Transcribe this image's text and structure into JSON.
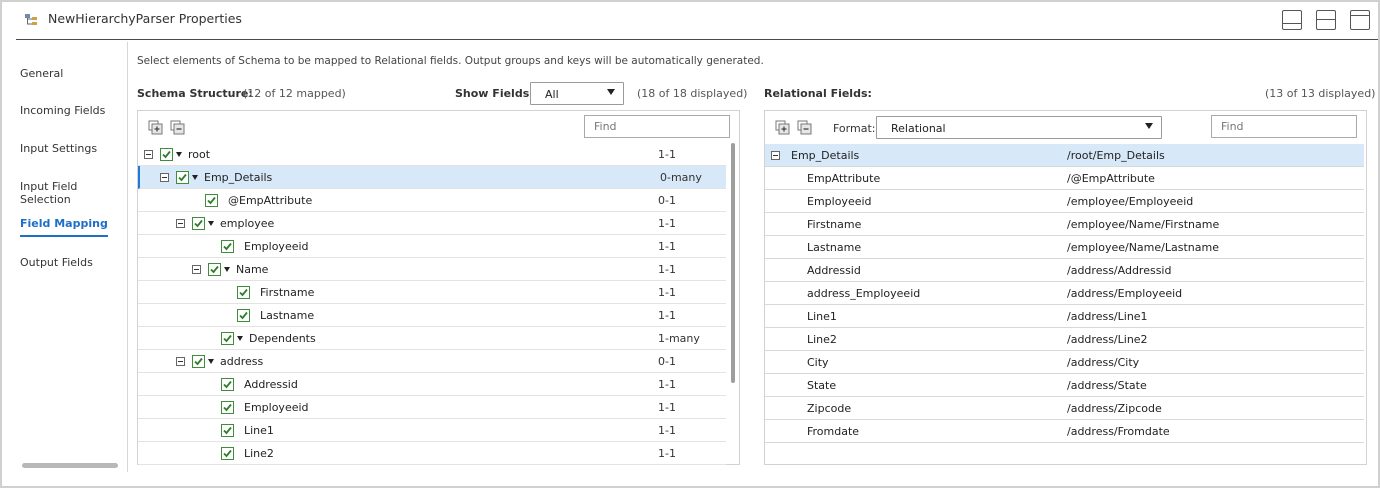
{
  "window": {
    "title": "NewHierarchyParser Properties"
  },
  "nav": {
    "items": [
      {
        "label": "General",
        "active": false
      },
      {
        "label": "Incoming Fields",
        "active": false
      },
      {
        "label": "Input Settings",
        "active": false
      },
      {
        "label": "Input Field Selection",
        "active": false
      },
      {
        "label": "Field Mapping",
        "active": true
      },
      {
        "label": "Output Fields",
        "active": false
      }
    ]
  },
  "instruction": "Select elements of Schema to be mapped to Relational fields. Output groups and keys will be automatically generated.",
  "schema": {
    "title": "Schema Structure:",
    "mapped": "(12 of 12 mapped)",
    "show_fields_label": "Show Fields:",
    "show_fields_value": "All",
    "displayed": "(18 of 18 displayed)",
    "find_placeholder": "Find",
    "rows": [
      {
        "label": "root",
        "card": "1-1",
        "level": 0,
        "expander": true,
        "caret": true,
        "selected": false
      },
      {
        "label": "Emp_Details",
        "card": "0-many",
        "level": 1,
        "expander": true,
        "caret": true,
        "selected": true
      },
      {
        "label": "@EmpAttribute",
        "card": "0-1",
        "level": 2,
        "expander": false,
        "caret": false,
        "selected": false
      },
      {
        "label": "employee",
        "card": "1-1",
        "level": 2,
        "expander": true,
        "caret": true,
        "selected": false
      },
      {
        "label": "Employeeid",
        "card": "1-1",
        "level": 3,
        "expander": false,
        "caret": false,
        "selected": false
      },
      {
        "label": "Name",
        "card": "1-1",
        "level": 3,
        "expander": true,
        "caret": true,
        "selected": false
      },
      {
        "label": "Firstname",
        "card": "1-1",
        "level": 4,
        "expander": false,
        "caret": false,
        "selected": false
      },
      {
        "label": "Lastname",
        "card": "1-1",
        "level": 4,
        "expander": false,
        "caret": false,
        "selected": false
      },
      {
        "label": "Dependents",
        "card": "1-many",
        "level": 3,
        "expander": false,
        "caret": true,
        "selected": false
      },
      {
        "label": "address",
        "card": "0-1",
        "level": 2,
        "expander": true,
        "caret": true,
        "selected": false
      },
      {
        "label": "Addressid",
        "card": "1-1",
        "level": 3,
        "expander": false,
        "caret": false,
        "selected": false
      },
      {
        "label": "Employeeid",
        "card": "1-1",
        "level": 3,
        "expander": false,
        "caret": false,
        "selected": false
      },
      {
        "label": "Line1",
        "card": "1-1",
        "level": 3,
        "expander": false,
        "caret": false,
        "selected": false
      },
      {
        "label": "Line2",
        "card": "1-1",
        "level": 3,
        "expander": false,
        "caret": false,
        "selected": false
      }
    ]
  },
  "relational": {
    "title": "Relational Fields:",
    "displayed": "(13 of 13 displayed)",
    "format_label": "Format:",
    "format_value": "Relational",
    "find_placeholder": "Find",
    "rows": [
      {
        "name": "Emp_Details",
        "path": "/root/Emp_Details",
        "group": true
      },
      {
        "name": "EmpAttribute",
        "path": "/@EmpAttribute",
        "group": false
      },
      {
        "name": "Employeeid",
        "path": "/employee/Employeeid",
        "group": false
      },
      {
        "name": "Firstname",
        "path": "/employee/Name/Firstname",
        "group": false
      },
      {
        "name": "Lastname",
        "path": "/employee/Name/Lastname",
        "group": false
      },
      {
        "name": "Addressid",
        "path": "/address/Addressid",
        "group": false
      },
      {
        "name": "address_Employeeid",
        "path": "/address/Employeeid",
        "group": false
      },
      {
        "name": "Line1",
        "path": "/address/Line1",
        "group": false
      },
      {
        "name": "Line2",
        "path": "/address/Line2",
        "group": false
      },
      {
        "name": "City",
        "path": "/address/City",
        "group": false
      },
      {
        "name": "State",
        "path": "/address/State",
        "group": false
      },
      {
        "name": "Zipcode",
        "path": "/address/Zipcode",
        "group": false
      },
      {
        "name": "Fromdate",
        "path": "/address/Fromdate",
        "group": false
      }
    ]
  },
  "colors": {
    "accent": "#1d6fc9",
    "checkbox": "#3f8d3a",
    "selected_row": "#d7e8f8"
  }
}
